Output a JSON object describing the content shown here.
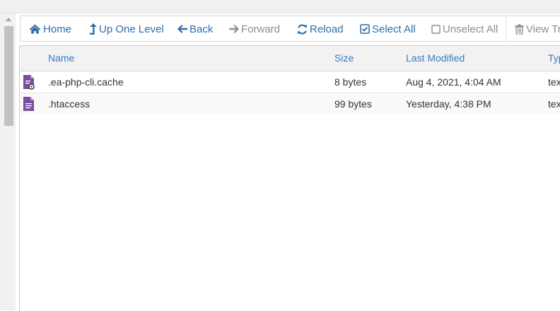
{
  "toolbar": {
    "home": "Home",
    "up_one_level": "Up One Level",
    "back": "Back",
    "forward": "Forward",
    "reload": "Reload",
    "select_all": "Select All",
    "unselect_all": "Unselect All",
    "view_trash": "View Tr"
  },
  "table": {
    "columns": {
      "name": "Name",
      "size": "Size",
      "last_modified": "Last Modified",
      "type": "Typ"
    },
    "rows": [
      {
        "name": ".ea-php-cli.cache",
        "size": "8 bytes",
        "last_modified": "Aug 4, 2021, 4:04 AM",
        "type": "tex",
        "icon": "file-cache-icon"
      },
      {
        "name": ".htaccess",
        "size": "99 bytes",
        "last_modified": "Yesterday, 4:38 PM",
        "type": "tex",
        "icon": "file-text-icon"
      }
    ]
  },
  "colors": {
    "link_blue": "#2f6fa8",
    "disabled_gray": "#8e8e8e",
    "file_icon_purple": "#7b4e9c"
  }
}
